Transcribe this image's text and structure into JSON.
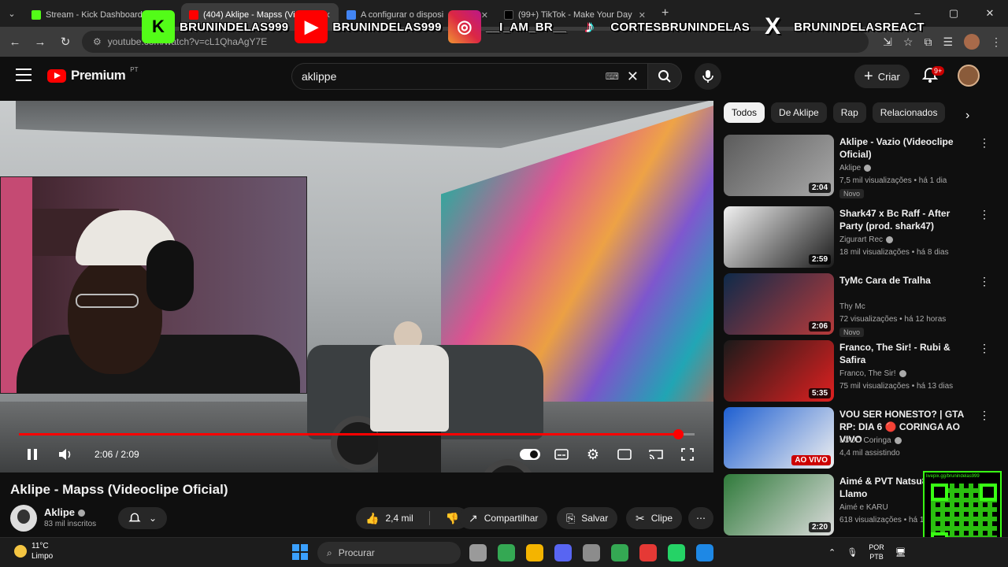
{
  "browser": {
    "tabs": [
      {
        "title": "Stream - Kick Dashboard",
        "color": "#53fc18",
        "active": false
      },
      {
        "title": "(404) Aklipe - Mapss (Vide",
        "color": "#ff0000",
        "active": true
      },
      {
        "title": "A configurar o disposi",
        "color": "#4285f4",
        "active": false
      },
      {
        "title": "(99+) TikTok - Make Your Day",
        "color": "#000000",
        "active": false
      }
    ],
    "url": "youtube.com/watch?v=cL1QhaAgY7E",
    "window_buttons": [
      "–",
      "▢",
      "✕"
    ]
  },
  "overlay": {
    "socials": [
      {
        "icon": "kick-icon",
        "glyph": "K",
        "bg": "#53fc18",
        "label": "BRUNINDELAS999"
      },
      {
        "icon": "youtube-icon",
        "glyph": "▶",
        "bg": "#ff0000",
        "label": "BRUNINDELAS999"
      },
      {
        "icon": "instagram-icon",
        "glyph": "◎",
        "bg": "#d6249f",
        "label": "__I_AM_BR__"
      },
      {
        "icon": "tiktok-icon",
        "glyph": "♪",
        "bg": "#000000",
        "label": "CORTESBRUNINDELAS"
      },
      {
        "icon": "x-icon",
        "glyph": "X",
        "bg": "#000000",
        "label": "BRUNINDELASREACT"
      }
    ]
  },
  "youtube": {
    "logo_text": "Premium",
    "logo_sup": "PT",
    "search_value": "aklippe",
    "create_label": "Criar",
    "notification_badge": "9+"
  },
  "player": {
    "current_time": "2:06",
    "duration": "2:09",
    "time_display": "2:06 / 2:09",
    "progress": 0.976
  },
  "video": {
    "title": "Aklipe - Mapss (Videoclipe Oficial)",
    "channel": "Aklipe",
    "subscribers": "83 mil inscritos",
    "likes": "2,4 mil",
    "share_label": "Compartilhar",
    "save_label": "Salvar",
    "clip_label": "Clipe"
  },
  "chips": [
    "Todos",
    "De Aklipe",
    "Rap",
    "Relacionados"
  ],
  "recommendations": [
    {
      "title": "Aklipe - Vazio (Videoclipe Oficial)",
      "channel": "Aklipe",
      "verified": true,
      "meta": "7,5 mil visualizações • há 1 dia",
      "duration": "2:04",
      "badge": "Novo",
      "thumb": "#5b5b5b",
      "thumb2": "#a9a9a9"
    },
    {
      "title": "Shark47 x Bc Raff - After Party (prod. shark47)",
      "channel": "Zigurart Rec",
      "verified": true,
      "meta": "18 mil visualizações • há 8 dias",
      "duration": "2:59",
      "badge": "",
      "thumb": "#f2f2f2",
      "thumb2": "#1a1a1a"
    },
    {
      "title": "TyMc  Cara de Tralha",
      "channel": "Thy Mc",
      "verified": false,
      "meta": "72 visualizações • há 12 horas",
      "duration": "2:06",
      "badge": "Novo",
      "thumb": "#0e2a4a",
      "thumb2": "#b83a3a"
    },
    {
      "title": "Franco, The Sir! - Rubi & Safira",
      "channel": "Franco, The Sir!",
      "verified": true,
      "meta": "75 mil visualizações • há 13 dias",
      "duration": "5:35",
      "badge": "",
      "thumb": "#1a1a1a",
      "thumb2": "#e02020"
    },
    {
      "title": "VOU SER HONESTO? | GTA RP: DIA 6 🔴 CORINGA AO VIVO",
      "channel": "LOUD Coringa",
      "verified": true,
      "meta": "4,4 mil assistindo",
      "duration": "AO VIVO",
      "badge": "",
      "thumb": "#1e5fd1",
      "thumb2": "#f0f0f0"
    },
    {
      "title": "Aimé & PVT Natsu8 - me Llamo",
      "channel": "Aimé e KARU",
      "verified": false,
      "meta": "618 visualizações • há 1",
      "duration": "2:20",
      "badge": "",
      "thumb": "#2f7a3a",
      "thumb2": "#dcdcdc"
    }
  ],
  "qr": {
    "caption": "livepix.gg/brunindelas999"
  },
  "taskbar": {
    "weather_temp": "11°C",
    "weather_desc": "Limpo",
    "search_placeholder": "Procurar",
    "lang_top": "POR",
    "lang_bottom": "PTB",
    "app_colors": [
      "#9a9a9a",
      "#34a853",
      "#f4b400",
      "#5865f2",
      "#8c8c8c",
      "#34a853",
      "#e53935",
      "#25d366",
      "#1e88e5"
    ]
  }
}
